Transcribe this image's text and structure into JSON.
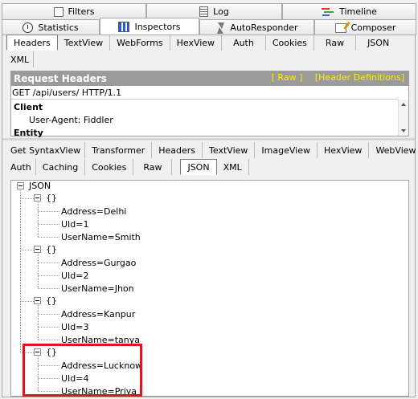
{
  "top_tabs_row1": [
    {
      "label": "Filters",
      "icon": "filters-icon"
    },
    {
      "label": "Log",
      "icon": "log-icon"
    },
    {
      "label": "Timeline",
      "icon": "timeline-icon"
    }
  ],
  "top_tabs_row2": [
    {
      "label": "Statistics",
      "icon": "statistics-icon"
    },
    {
      "label": "Inspectors",
      "icon": "inspectors-icon",
      "active": true
    },
    {
      "label": "AutoResponder",
      "icon": "autoresponder-icon"
    },
    {
      "label": "Composer",
      "icon": "composer-icon"
    }
  ],
  "request_tabs": [
    "Headers",
    "TextView",
    "WebForms",
    "HexView",
    "Auth",
    "Cookies",
    "Raw",
    "JSON",
    "XML"
  ],
  "request_selected": "Headers",
  "request_headers": {
    "title": "Request Headers",
    "raw_link": "[ Raw ]",
    "defs_link": "[Header Definitions]",
    "request_line": "GET /api/users/ HTTP/1.1",
    "group_client": "Client",
    "user_agent": "User-Agent: Fiddler",
    "group_entity": "Entity"
  },
  "response_tabs_row1": [
    "Get SyntaxView",
    "Transformer",
    "Headers",
    "TextView",
    "ImageView",
    "HexView",
    "WebView"
  ],
  "response_tabs_row2": [
    "Auth",
    "Caching",
    "Cookies",
    "Raw",
    "JSON",
    "XML"
  ],
  "response_selected": "JSON",
  "json_tree": {
    "root": "JSON",
    "object_label": "{}",
    "objects": [
      [
        "Address=Delhi",
        "UId=1",
        "UserName=Smith"
      ],
      [
        "Address=Gurgao",
        "UId=2",
        "UserName=Jhon"
      ],
      [
        "Address=Kanpur",
        "UId=3",
        "UserName=tanya"
      ],
      [
        "Address=Lucknow",
        "UId=4",
        "UserName=Priya"
      ]
    ]
  },
  "colors": {
    "highlight": "#e0131f",
    "header_bar": "#9b9b9b",
    "links": "#ffea00"
  }
}
